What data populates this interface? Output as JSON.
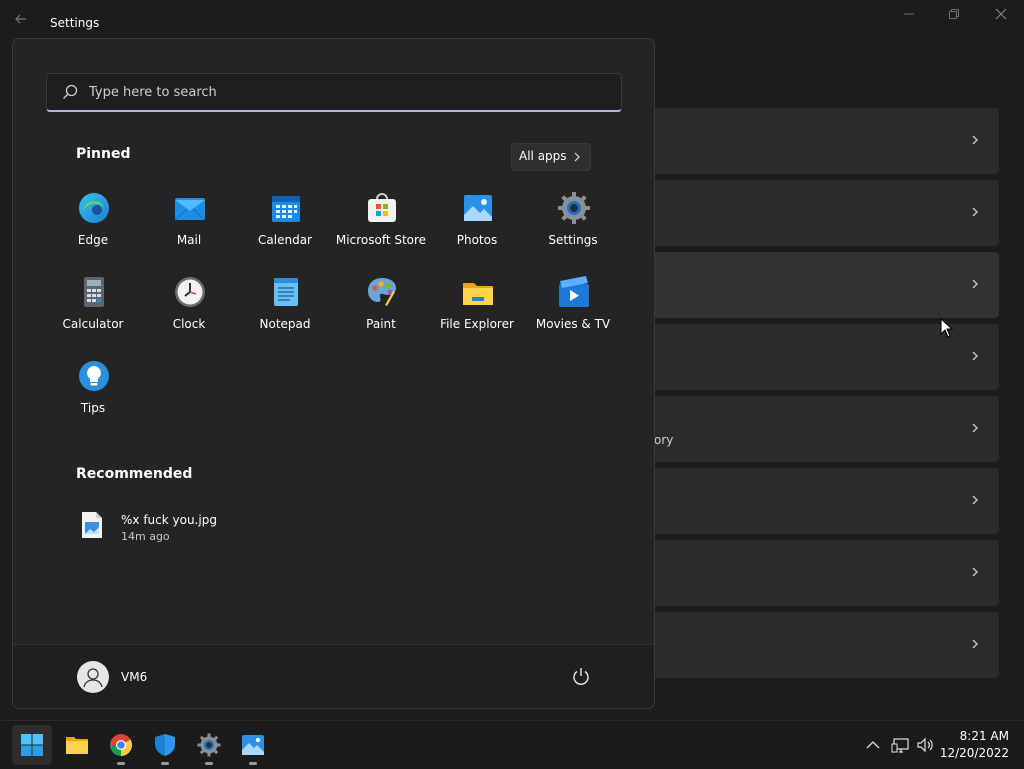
{
  "window": {
    "title": "Settings",
    "partial_text": "ory"
  },
  "search": {
    "placeholder": "Type here to search"
  },
  "pinned": {
    "title": "Pinned",
    "all_apps_label": "All apps",
    "apps": [
      {
        "label": "Edge",
        "icon": "edge-icon"
      },
      {
        "label": "Mail",
        "icon": "mail-icon"
      },
      {
        "label": "Calendar",
        "icon": "calendar-icon"
      },
      {
        "label": "Microsoft Store",
        "icon": "store-icon"
      },
      {
        "label": "Photos",
        "icon": "photos-icon"
      },
      {
        "label": "Settings",
        "icon": "settings-icon"
      },
      {
        "label": "Calculator",
        "icon": "calculator-icon"
      },
      {
        "label": "Clock",
        "icon": "clock-icon"
      },
      {
        "label": "Notepad",
        "icon": "notepad-icon"
      },
      {
        "label": "Paint",
        "icon": "paint-icon"
      },
      {
        "label": "File Explorer",
        "icon": "file-explorer-icon"
      },
      {
        "label": "Movies & TV",
        "icon": "movies-tv-icon"
      },
      {
        "label": "Tips",
        "icon": "tips-icon"
      }
    ]
  },
  "recommended": {
    "title": "Recommended",
    "items": [
      {
        "name": "%x fuck you.jpg",
        "time": "14m ago",
        "icon": "image-file-icon"
      }
    ]
  },
  "user": {
    "name": "VM6"
  },
  "clock": {
    "time": "8:21 AM",
    "date": "12/20/2022"
  },
  "colors": {
    "accent": "#0078d4",
    "search_underline": "#c9a9e6"
  }
}
